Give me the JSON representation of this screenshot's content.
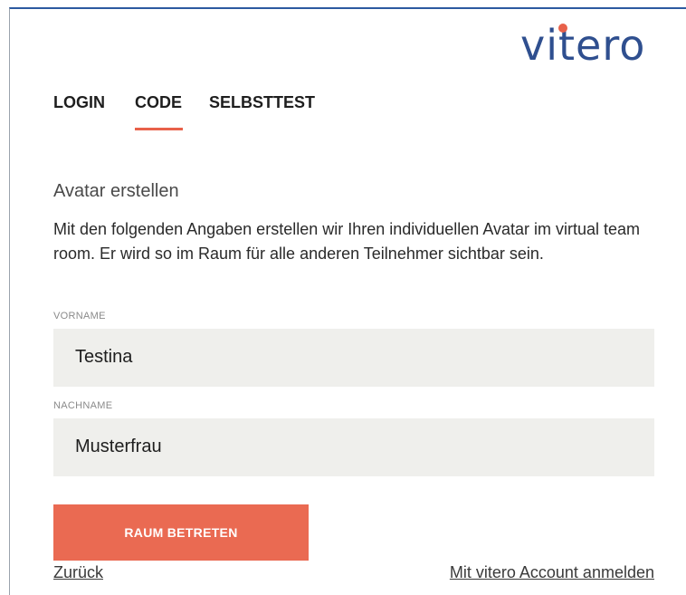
{
  "brand": {
    "logo_text": "vitero",
    "logo_color": "#2f4f8f",
    "accent_color": "#e8614a"
  },
  "tabs": [
    {
      "label": "LOGIN",
      "active": false
    },
    {
      "label": "CODE",
      "active": true
    },
    {
      "label": "SELBSTTEST",
      "active": false
    }
  ],
  "form": {
    "title": "Avatar erstellen",
    "description": "Mit den folgenden Angaben erstellen wir Ihren individuellen Avatar im virtual team room. Er wird so im Raum für alle anderen Teilnehmer sichtbar sein.",
    "first_name": {
      "label": "VORNAME",
      "value": "Testina"
    },
    "last_name": {
      "label": "NACHNAME",
      "value": "Musterfrau"
    },
    "submit_label": "RAUM BETRETEN"
  },
  "links": {
    "back": "Zurück",
    "account_login": "Mit vitero Account anmelden"
  }
}
